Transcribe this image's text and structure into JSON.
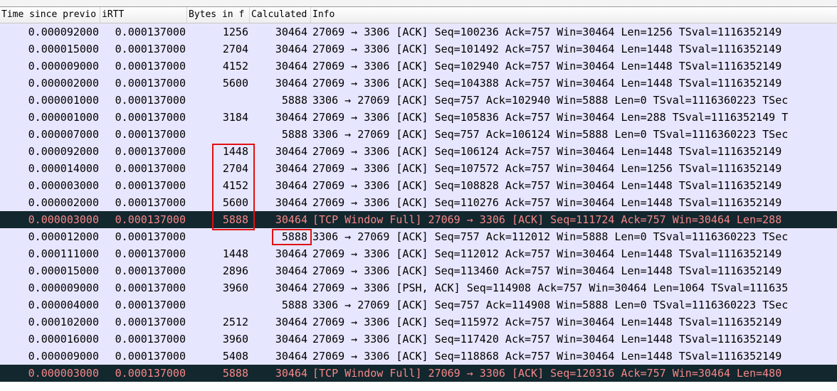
{
  "columns": [
    {
      "label": "Time since previo"
    },
    {
      "label": "iRTT"
    },
    {
      "label": "Bytes in f"
    },
    {
      "label": "Calculated"
    },
    {
      "label": "Info"
    }
  ],
  "rows": [
    {
      "time": "0.000092000",
      "irtt": "0.000137000",
      "bif": "1256",
      "calc": "30464",
      "info": "27069 → 3306 [ACK] Seq=100236 Ack=757 Win=30464 Len=1256 TSval=1116352149"
    },
    {
      "time": "0.000015000",
      "irtt": "0.000137000",
      "bif": "2704",
      "calc": "30464",
      "info": "27069 → 3306 [ACK] Seq=101492 Ack=757 Win=30464 Len=1448 TSval=1116352149"
    },
    {
      "time": "0.000009000",
      "irtt": "0.000137000",
      "bif": "4152",
      "calc": "30464",
      "info": "27069 → 3306 [ACK] Seq=102940 Ack=757 Win=30464 Len=1448 TSval=1116352149"
    },
    {
      "time": "0.000002000",
      "irtt": "0.000137000",
      "bif": "5600",
      "calc": "30464",
      "info": "27069 → 3306 [ACK] Seq=104388 Ack=757 Win=30464 Len=1448 TSval=1116352149"
    },
    {
      "time": "0.000001000",
      "irtt": "0.000137000",
      "bif": "",
      "calc": "5888",
      "info": "3306 → 27069 [ACK] Seq=757 Ack=102940 Win=5888 Len=0 TSval=1116360223 TSec"
    },
    {
      "time": "0.000001000",
      "irtt": "0.000137000",
      "bif": "3184",
      "calc": "30464",
      "info": "27069 → 3306 [ACK] Seq=105836 Ack=757 Win=30464 Len=288 TSval=1116352149 T"
    },
    {
      "time": "0.000007000",
      "irtt": "0.000137000",
      "bif": "",
      "calc": "5888",
      "info": "3306 → 27069 [ACK] Seq=757 Ack=106124 Win=5888 Len=0 TSval=1116360223 TSec"
    },
    {
      "time": "0.000092000",
      "irtt": "0.000137000",
      "bif": "1448",
      "calc": "30464",
      "info": "27069 → 3306 [ACK] Seq=106124 Ack=757 Win=30464 Len=1448 TSval=1116352149"
    },
    {
      "time": "0.000014000",
      "irtt": "0.000137000",
      "bif": "2704",
      "calc": "30464",
      "info": "27069 → 3306 [ACK] Seq=107572 Ack=757 Win=30464 Len=1256 TSval=1116352149"
    },
    {
      "time": "0.000003000",
      "irtt": "0.000137000",
      "bif": "4152",
      "calc": "30464",
      "info": "27069 → 3306 [ACK] Seq=108828 Ack=757 Win=30464 Len=1448 TSval=1116352149"
    },
    {
      "time": "0.000002000",
      "irtt": "0.000137000",
      "bif": "5600",
      "calc": "30464",
      "info": "27069 → 3306 [ACK] Seq=110276 Ack=757 Win=30464 Len=1448 TSval=1116352149"
    },
    {
      "time": "0.000003000",
      "irtt": "0.000137000",
      "bif": "5888",
      "calc": "30464",
      "info": "[TCP Window Full] 27069 → 3306 [ACK] Seq=111724 Ack=757 Win=30464 Len=288",
      "selected": true
    },
    {
      "time": "0.000012000",
      "irtt": "0.000137000",
      "bif": "",
      "calc": "5888",
      "info": "3306 → 27069 [ACK] Seq=757 Ack=112012 Win=5888 Len=0 TSval=1116360223 TSec"
    },
    {
      "time": "0.000111000",
      "irtt": "0.000137000",
      "bif": "1448",
      "calc": "30464",
      "info": "27069 → 3306 [ACK] Seq=112012 Ack=757 Win=30464 Len=1448 TSval=1116352149"
    },
    {
      "time": "0.000015000",
      "irtt": "0.000137000",
      "bif": "2896",
      "calc": "30464",
      "info": "27069 → 3306 [ACK] Seq=113460 Ack=757 Win=30464 Len=1448 TSval=1116352149"
    },
    {
      "time": "0.000009000",
      "irtt": "0.000137000",
      "bif": "3960",
      "calc": "30464",
      "info": "27069 → 3306 [PSH, ACK] Seq=114908 Ack=757 Win=30464 Len=1064 TSval=111635"
    },
    {
      "time": "0.000004000",
      "irtt": "0.000137000",
      "bif": "",
      "calc": "5888",
      "info": "3306 → 27069 [ACK] Seq=757 Ack=114908 Win=5888 Len=0 TSval=1116360223 TSec"
    },
    {
      "time": "0.000102000",
      "irtt": "0.000137000",
      "bif": "2512",
      "calc": "30464",
      "info": "27069 → 3306 [ACK] Seq=115972 Ack=757 Win=30464 Len=1448 TSval=1116352149"
    },
    {
      "time": "0.000016000",
      "irtt": "0.000137000",
      "bif": "3960",
      "calc": "30464",
      "info": "27069 → 3306 [ACK] Seq=117420 Ack=757 Win=30464 Len=1448 TSval=1116352149"
    },
    {
      "time": "0.000009000",
      "irtt": "0.000137000",
      "bif": "5408",
      "calc": "30464",
      "info": "27069 → 3306 [ACK] Seq=118868 Ack=757 Win=30464 Len=1448 TSval=1116352149"
    },
    {
      "time": "0.000003000",
      "irtt": "0.000137000",
      "bif": "5888",
      "calc": "30464",
      "info": "[TCP Window Full] 27069 → 3306 [ACK] Seq=120316 Ack=757 Win=30464 Len=480",
      "selected": true
    }
  ],
  "colors": {
    "row_bg": "#e7e6ff",
    "selected_bg": "#12272e",
    "selected_fg": "#f78787",
    "highlight_box": "#e01010"
  }
}
